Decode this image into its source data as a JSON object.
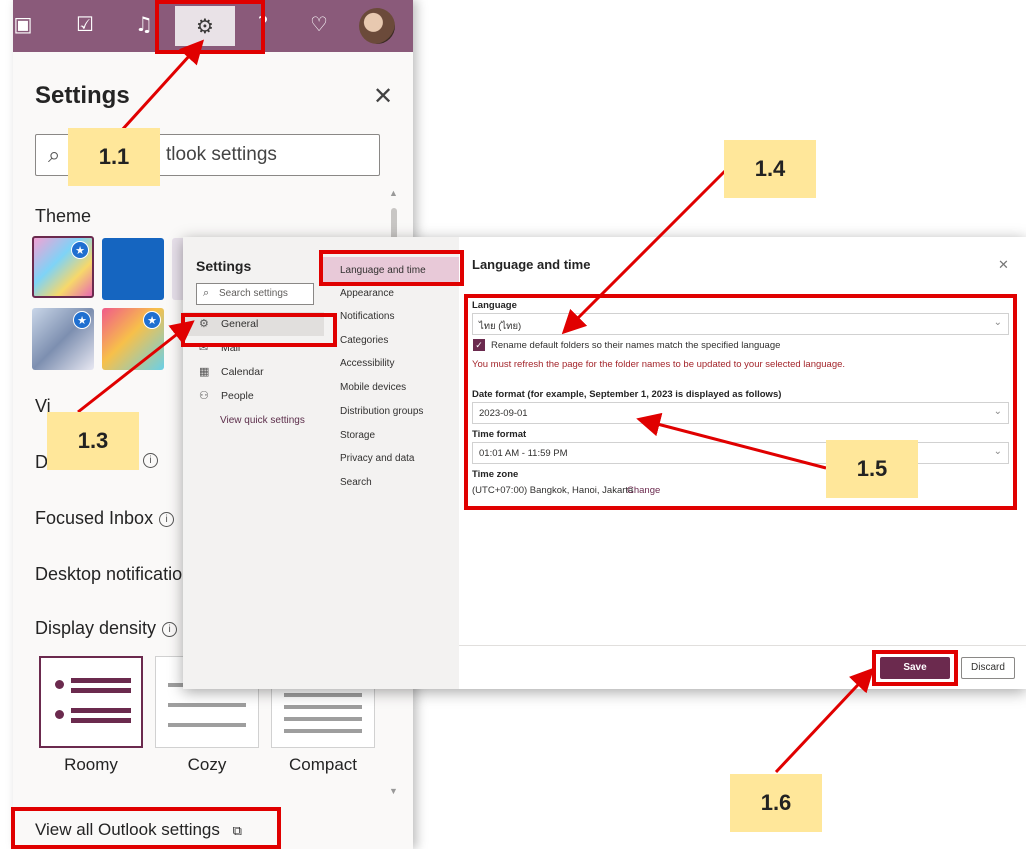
{
  "quick_settings": {
    "title": "Settings",
    "close_icon": "✕",
    "search_placeholder": "tlook settings",
    "theme_heading": "Theme",
    "view_all_partial": "Vi",
    "dark_mode_partial": "D",
    "focused_inbox": "Focused Inbox",
    "desktop_notifications": "Desktop notificatio",
    "display_density": "Display density",
    "density_options": [
      "Roomy",
      "Cozy",
      "Compact"
    ],
    "view_all_settings": "View all Outlook settings",
    "icons": [
      "onenote-icon",
      "tasks-icon",
      "bell-icon",
      "gear-icon",
      "lightbulb-icon",
      "search-icon",
      "info-icon",
      "popout-icon"
    ]
  },
  "dialog": {
    "title": "Settings",
    "search_placeholder": "Search settings",
    "nav_main": [
      {
        "label": "General",
        "icon": "⚙"
      },
      {
        "label": "Mail",
        "icon": "✉"
      },
      {
        "label": "Calendar",
        "icon": "▦"
      },
      {
        "label": "People",
        "icon": "⚇"
      }
    ],
    "quick_link": "View quick settings",
    "nav_sub": [
      "Language and time",
      "Appearance",
      "Notifications",
      "Categories",
      "Accessibility",
      "Mobile devices",
      "Distribution groups",
      "Storage",
      "Privacy and data",
      "Search"
    ],
    "panel": {
      "title": "Language and time",
      "language_label": "Language",
      "language_value": "ไทย (ไทย)",
      "rename_checkbox": "Rename default folders so their names match the specified language",
      "refresh_note": "You must refresh the page for the folder names to be updated to your selected language.",
      "date_label": "Date format (for example, September 1, 2023 is displayed as follows)",
      "date_value": "2023-09-01",
      "time_label": "Time format",
      "time_value": "01:01 AM - 11:59 PM",
      "tz_label": "Time zone",
      "tz_value": "(UTC+07:00) Bangkok, Hanoi, Jakarta",
      "tz_change": "Change",
      "save": "Save",
      "discard": "Discard"
    }
  },
  "annotations": {
    "steps": [
      "1.1",
      "1.3",
      "1.4",
      "1.5",
      "1.6"
    ],
    "highlight_color": "#e00000",
    "label_bg": "#ffe79a"
  },
  "colors": {
    "accent": "#6b2a4e",
    "topbar": "#8a5a7a",
    "error_text": "#a4262c"
  }
}
